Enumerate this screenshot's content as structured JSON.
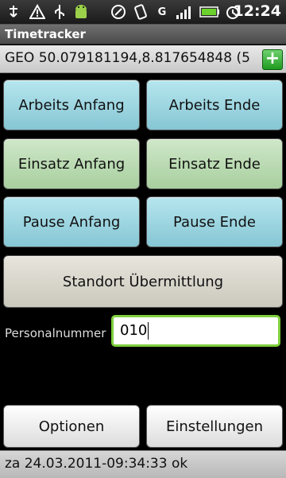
{
  "status_bar": {
    "time": "12:24",
    "icons": [
      "usb-icon",
      "alert-icon",
      "android-icon",
      "signal-icon",
      "rotate-icon",
      "data-g-icon",
      "battery-icon",
      "alarm-icon"
    ]
  },
  "app": {
    "title": "Timetracker"
  },
  "geo": {
    "text": "GEO 50.079181194,8.817654848 (5",
    "add_label": "+"
  },
  "buttons": {
    "work_start": "Arbeits Anfang",
    "work_end": "Arbeits Ende",
    "mission_start": "Einsatz Anfang",
    "mission_end": "Einsatz Ende",
    "pause_start": "Pause Anfang",
    "pause_end": "Pause Ende",
    "location": "Standort Übermittlung",
    "options": "Optionen",
    "settings": "Einstellungen"
  },
  "personnel": {
    "label": "Personalnummer",
    "value": "010"
  },
  "status_text": "za 24.03.2011-09:34:33 ok",
  "colors": {
    "accent_green": "#7ecf3d",
    "button_blue": "#a6dbe6",
    "button_green": "#bcdcb3"
  }
}
